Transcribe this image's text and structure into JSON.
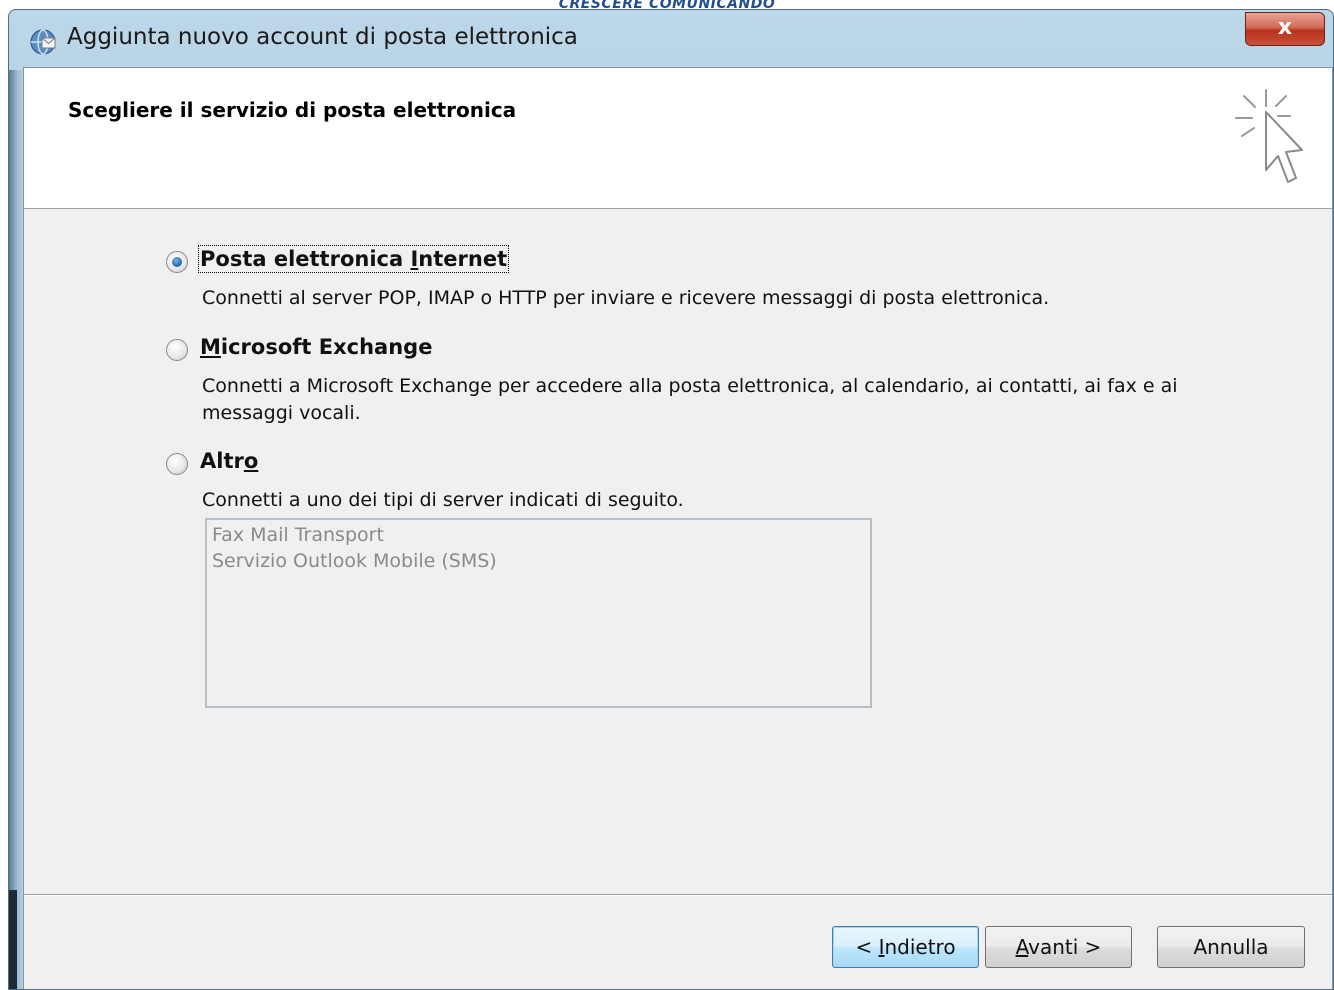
{
  "watermark": "CRESCERE COMUNICANDO",
  "window": {
    "title": "Aggiunta nuovo account di posta elettronica",
    "close_label": "x"
  },
  "header": {
    "title": "Scegliere il servizio di posta elettronica"
  },
  "options": [
    {
      "label_parts": [
        "Posta elettronica ",
        "I",
        "nternet"
      ],
      "description": "Connetti al server POP, IMAP o HTTP per inviare e ricevere messaggi di posta elettronica.",
      "checked": true
    },
    {
      "label_parts": [
        "",
        "M",
        "icrosoft Exchange"
      ],
      "description": "Connetti a Microsoft Exchange per accedere alla posta elettronica, al calendario, ai contatti, ai fax e ai messaggi vocali.",
      "checked": false
    },
    {
      "label_parts": [
        "Altr",
        "o",
        ""
      ],
      "description": "Connetti a uno dei tipi di server indicati di seguito.",
      "checked": false
    }
  ],
  "server_list": {
    "items": [
      "Fax Mail Transport",
      "Servizio Outlook Mobile (SMS)"
    ]
  },
  "buttons": {
    "back": {
      "prefix": "< ",
      "accel": "I",
      "rest": "ndietro"
    },
    "next": {
      "accel": "A",
      "rest": "vanti >"
    },
    "cancel": "Annulla"
  }
}
